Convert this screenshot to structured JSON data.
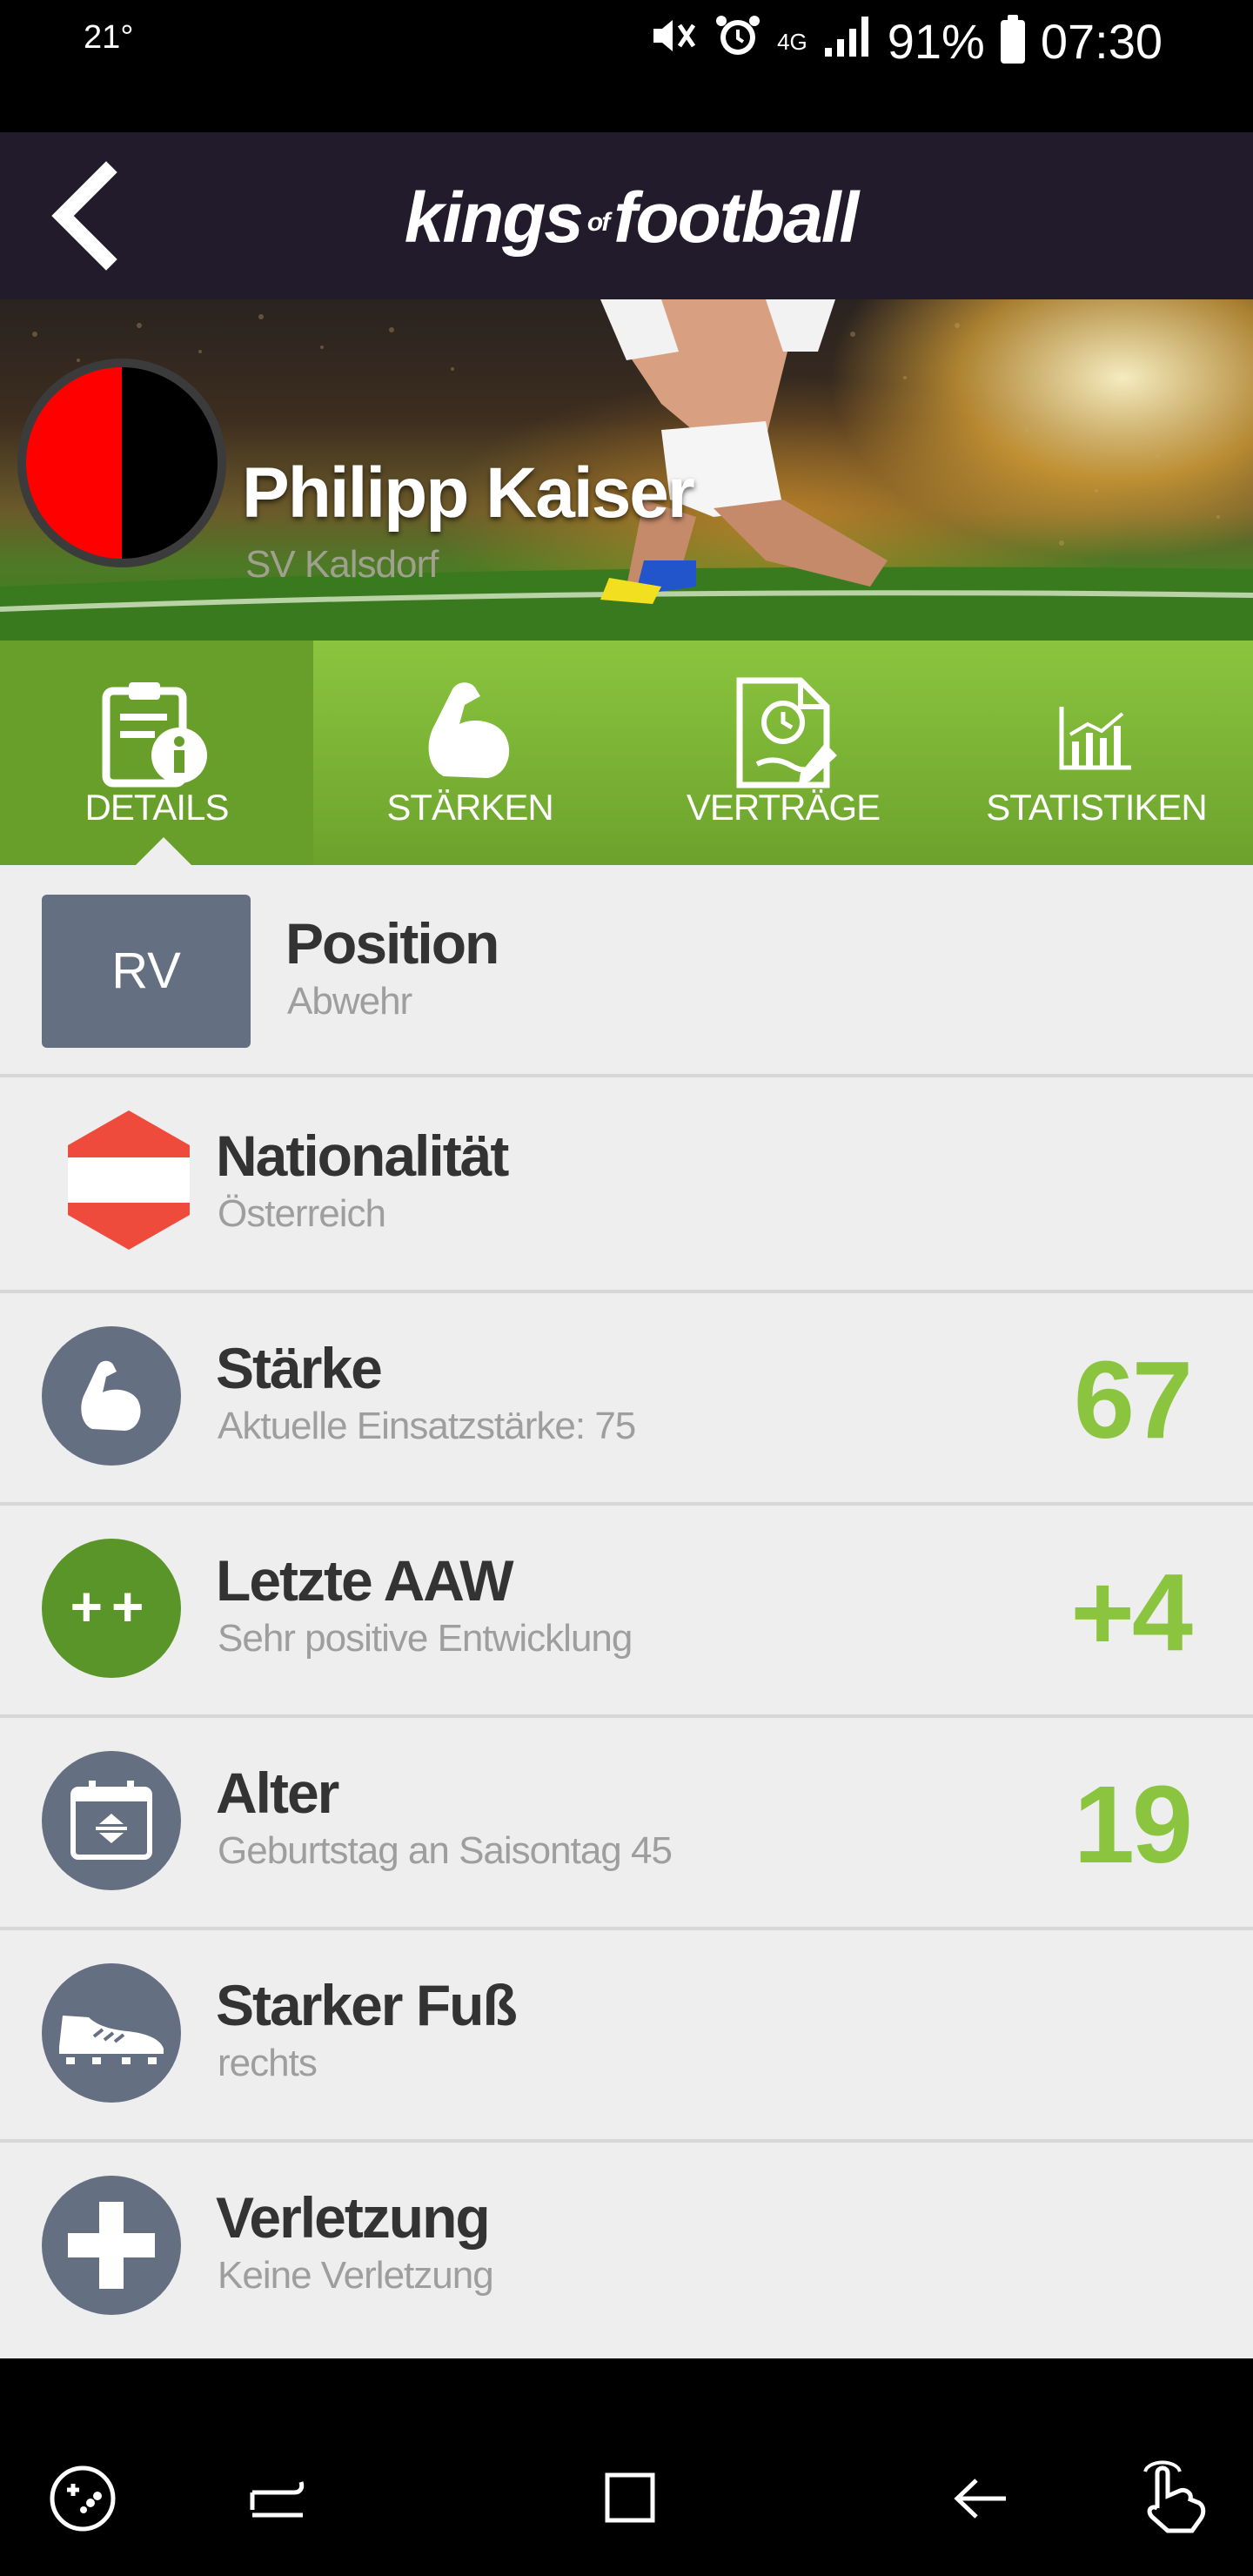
{
  "status_bar": {
    "temperature": "21°",
    "network": "4G",
    "battery": "91%",
    "time": "07:30"
  },
  "app_bar": {
    "logo_part1": "kings",
    "logo_part2": "of",
    "logo_part3": "football"
  },
  "player": {
    "name": "Philipp Kaiser",
    "club": "SV Kalsdorf"
  },
  "tabs": [
    {
      "label": "DETAILS",
      "icon": "clipboard-info-icon",
      "active": true
    },
    {
      "label": "STÄRKEN",
      "icon": "flexed-arm-icon",
      "active": false
    },
    {
      "label": "VERTRÄGE",
      "icon": "contract-clock-icon",
      "active": false
    },
    {
      "label": "STATISTIKEN",
      "icon": "bar-chart-icon",
      "active": false
    }
  ],
  "details": {
    "position": {
      "badge": "RV",
      "title": "Position",
      "subtitle": "Abwehr"
    },
    "nationality": {
      "title": "Nationalität",
      "subtitle": "Österreich",
      "flag_colors": [
        "#ef4b3c",
        "#ffffff",
        "#ef4b3c"
      ]
    },
    "strength": {
      "title": "Stärke",
      "subtitle": "Aktuelle Einsatzstärke: 75",
      "value": "67"
    },
    "last_aaw": {
      "title": "Letzte AAW",
      "subtitle": "Sehr positive Entwicklung",
      "value": "+4",
      "icon_text": "++"
    },
    "age": {
      "title": "Alter",
      "subtitle": "Geburtstag an Saisontag 45",
      "value": "19"
    },
    "strong_foot": {
      "title": "Starker Fuß",
      "subtitle": "rechts"
    },
    "injury": {
      "title": "Verletzung",
      "subtitle": "Keine Verletzung"
    }
  },
  "colors": {
    "accent_green": "#8bc53f",
    "dark_green": "#5a952a",
    "icon_gray": "#656f82",
    "app_bar": "#211b2c",
    "club_red": "#ff0000",
    "club_black": "#000000"
  }
}
